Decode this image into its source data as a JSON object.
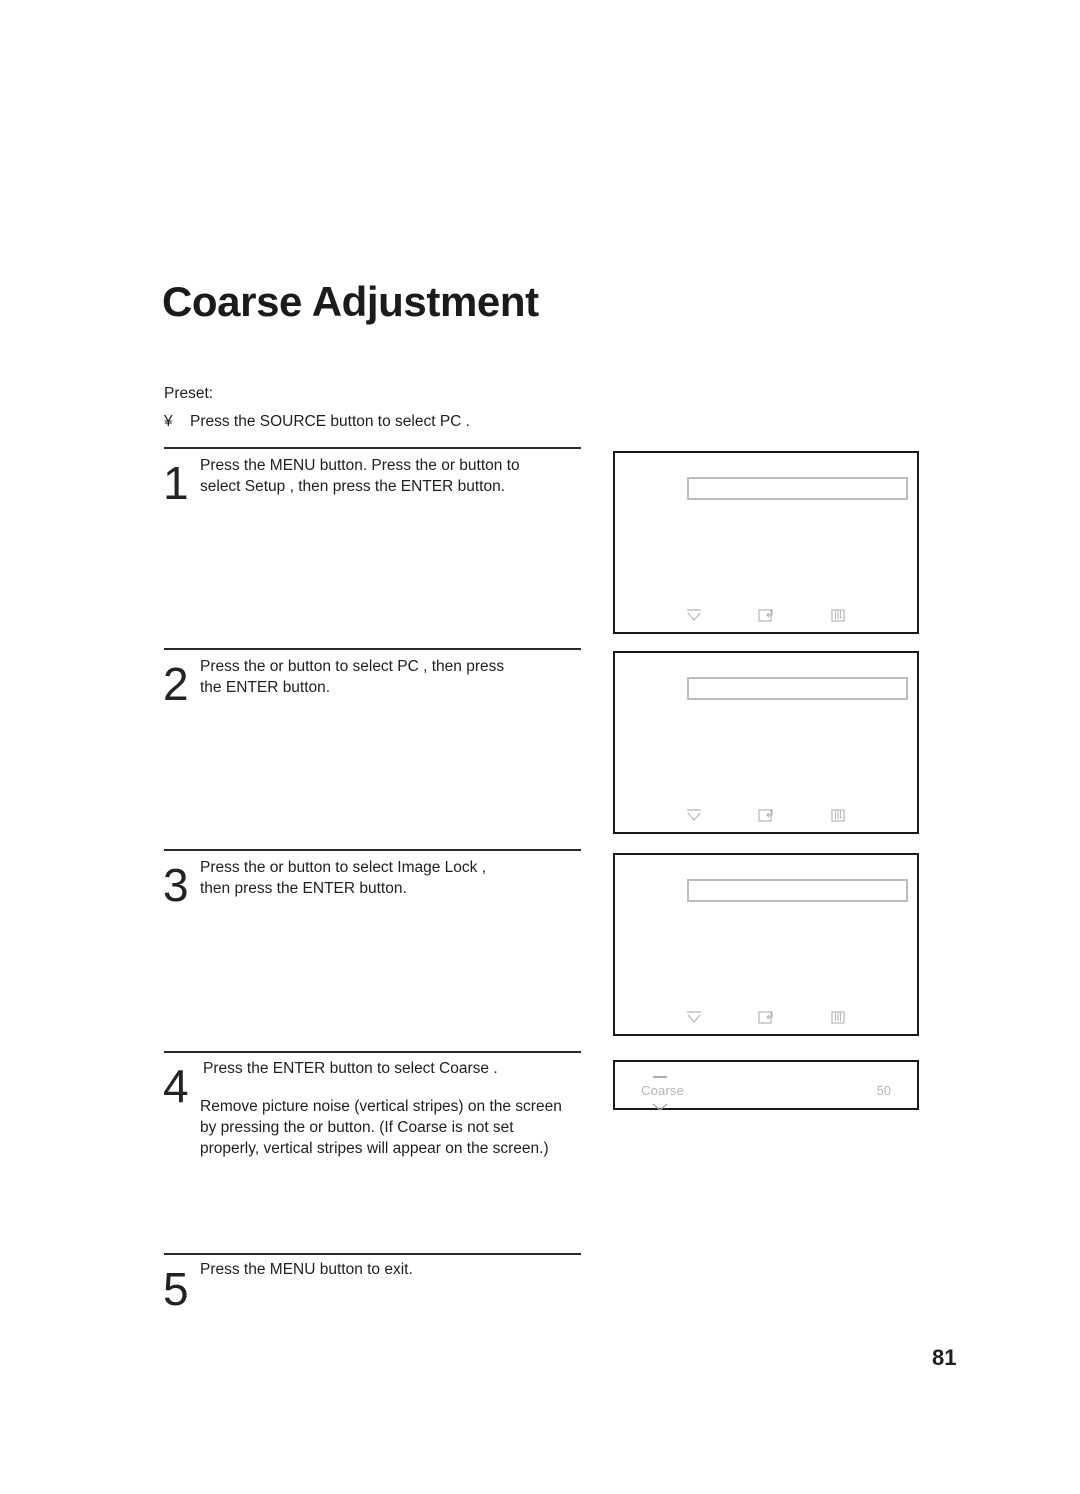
{
  "document": {
    "title": "Coarse Adjustment",
    "page_number": "81"
  },
  "preset": {
    "label": "Preset:",
    "bullet": "¥",
    "item_text": "Press the SOURCE button to select  PC ."
  },
  "steps": [
    {
      "number": "1",
      "lines": [
        "Press the MENU button. Press the  or     button to",
        "select  Setup , then press the ENTER button."
      ]
    },
    {
      "number": "2",
      "lines": [
        "Press the   or     button to select  PC , then press",
        "the ENTER button."
      ]
    },
    {
      "number": "3",
      "lines": [
        "Press the   or     button to select  Image Lock ,",
        "then press the ENTER button."
      ]
    },
    {
      "number": "4",
      "lines": [
        "Press the ENTER button to select  Coarse .",
        "",
        "Remove picture noise (vertical stripes) on the screen",
        "by pressing the    or     button. (If Coarse is not set",
        "properly, vertical stripes will appear on the screen.)"
      ]
    },
    {
      "number": "5",
      "lines": [
        "Press the MENU button to exit."
      ]
    }
  ],
  "osd_screens": [
    {
      "caption": "osd-screen-step-1",
      "footer_icons": [
        "move-down-icon",
        "enter-icon",
        "menu-exit-icon"
      ]
    },
    {
      "caption": "osd-screen-step-2",
      "footer_icons": [
        "move-down-icon",
        "enter-icon",
        "menu-exit-icon"
      ]
    },
    {
      "caption": "osd-screen-step-3",
      "footer_icons": [
        "move-down-icon",
        "enter-icon",
        "menu-exit-icon"
      ]
    }
  ],
  "osd_slider": {
    "label": "Coarse",
    "value": "50"
  },
  "colors": {
    "text": "#1f1f1f",
    "rule": "#2b2b2b",
    "osd_border": "#191919",
    "osd_faint": "#b5b5b5"
  }
}
